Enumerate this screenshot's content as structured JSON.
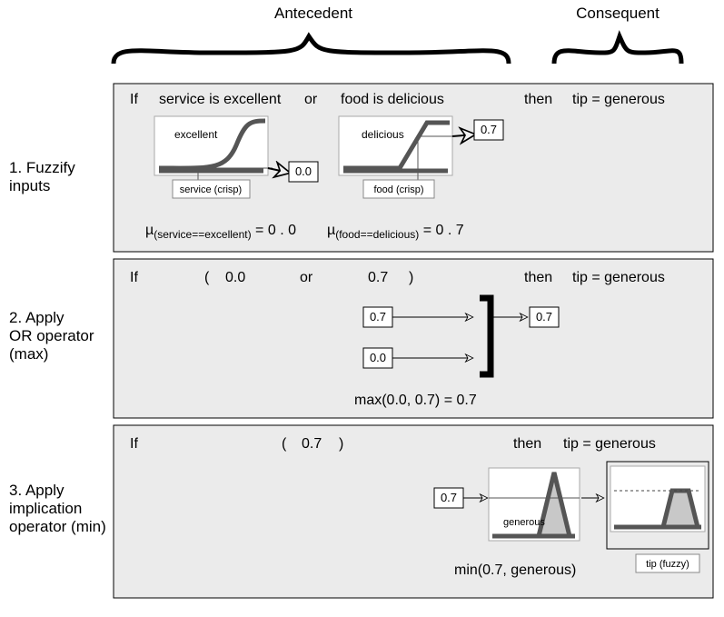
{
  "header": {
    "antecedent": "Antecedent",
    "consequent": "Consequent"
  },
  "step1": {
    "label_line1": "1. Fuzzify",
    "label_line2": "inputs",
    "rule": {
      "if": "If",
      "cond1": "service is excellent",
      "or": "or",
      "cond2": "food is delicious",
      "then": "then",
      "result": "tip = generous"
    },
    "mini1": {
      "label": "excellent",
      "input_label": "service (crisp)",
      "out": "0.0"
    },
    "mini2": {
      "label": "delicious",
      "input_label": "food (crisp)",
      "out": "0.7"
    },
    "mu1": "µ",
    "mu1_sub": "(service==excellent)",
    "mu1_eq": " = 0 . 0",
    "mu2": "µ",
    "mu2_sub": "(food==delicious)",
    "mu2_eq": " = 0 . 7"
  },
  "step2": {
    "label_line1": "2. Apply",
    "label_line2": "OR operator",
    "label_line3": "(max)",
    "rule": {
      "if": "If",
      "lp": "(",
      "a": "0.0",
      "or": "or",
      "b": "0.7",
      "rp": ")",
      "then": "then",
      "result": "tip = generous"
    },
    "in_top": "0.7",
    "in_bot": "0.0",
    "out": "0.7",
    "eq": "max(0.0, 0.7) = 0.7"
  },
  "step3": {
    "label_line1": "3. Apply",
    "label_line2": "implication",
    "label_line3": "operator (min)",
    "rule": {
      "if": "If",
      "lp": "(",
      "a": "0.7",
      "rp": ")",
      "then": "then",
      "result": "tip = generous"
    },
    "in": "0.7",
    "mf_label": "generous",
    "eq": "min(0.7, generous)",
    "out_label": "tip (fuzzy)"
  }
}
